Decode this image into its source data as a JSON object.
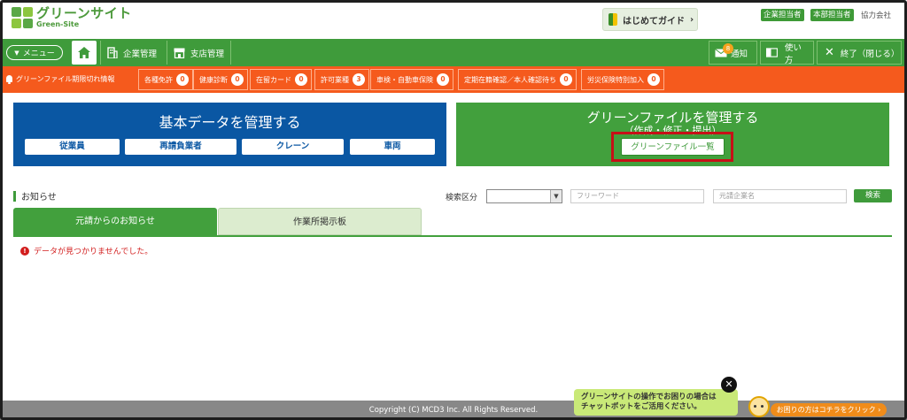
{
  "logo": {
    "jp": "グリーンサイト",
    "en": "Green-Site"
  },
  "header": {
    "guide_label": "はじめてガイド",
    "roles": [
      "企業担当者",
      "本部担当者"
    ],
    "company": "協力会社"
  },
  "nav": {
    "menu_label": "メニュー",
    "items": [
      {
        "label": "企業管理",
        "icon": "building-icon"
      },
      {
        "label": "支店管理",
        "icon": "store-icon"
      }
    ],
    "notice_label": "通知",
    "notice_count": "8",
    "help_label": "使い方",
    "exit_label": "終了（閉じる）"
  },
  "alerts": {
    "title": "グリーンファイル期限切れ情報",
    "chips": [
      {
        "label": "各種免許",
        "count": "0"
      },
      {
        "label": "健康診断",
        "count": "0"
      },
      {
        "label": "在留カード",
        "count": "0"
      },
      {
        "label": "許可業種",
        "count": "3"
      },
      {
        "label": "車検・自動車保険",
        "count": "0"
      },
      {
        "label": "定期在籍確認／本人確認待ち",
        "count": "0"
      },
      {
        "label": "労災保険特別加入",
        "count": "0"
      }
    ]
  },
  "panels": {
    "basic": {
      "title": "基本データを管理する",
      "buttons": [
        "従業員",
        "再請負業者",
        "クレーン",
        "車両"
      ]
    },
    "green": {
      "title": "グリーンファイルを管理する",
      "subtitle": "（作成・修正・提出）",
      "button": "グリーンファイル一覧"
    }
  },
  "notices": {
    "heading": "お知らせ",
    "search_label": "検索区分",
    "freeword_placeholder": "フリーワード",
    "company_placeholder": "元請企業名",
    "search_button": "検索",
    "tabs": [
      "元請からのお知らせ",
      "作業所掲示板"
    ],
    "empty_message": "データが見つかりませんでした。"
  },
  "footer": {
    "copyright": "Copyright (C) MCD3 Inc. All Rights Reserved."
  },
  "chat": {
    "bubble_line1": "グリーンサイトの操作でお困りの場合は",
    "bubble_line2": "チャットボットをご活用ください。",
    "button": "お困りの方はコチラをクリック"
  },
  "colors": {
    "green": "#3f9b3b",
    "orange": "#f55a1d",
    "blue": "#0a57a3",
    "red": "#c61017"
  }
}
